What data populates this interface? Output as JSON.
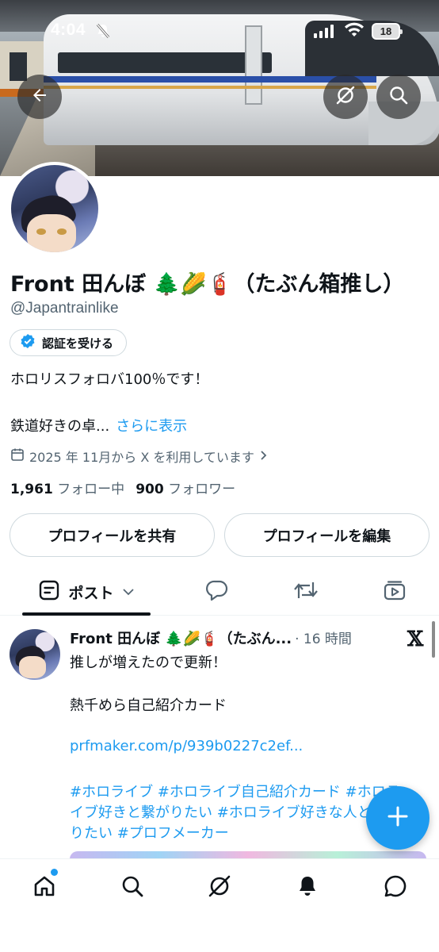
{
  "status_bar": {
    "time": "4:04",
    "battery": "18"
  },
  "profile": {
    "display_name": "Front 田んぼ 🌲🌽🧯（たぶん箱推し）",
    "handle": "@Japantrainlike",
    "verify_label": "認証を受ける",
    "bio_line1": "ホロリスフォロバ100％です！",
    "bio_line2": "鉄道好きの卓...",
    "show_more": "さらに表示",
    "joined": "2025 年 11月から X を利用しています",
    "following_count": "1,961",
    "following_label": "フォロー中",
    "followers_count": "900",
    "followers_label": "フォロワー",
    "share_button": "プロフィールを共有",
    "edit_button": "プロフィールを編集"
  },
  "tabs": {
    "posts_label": "ポスト"
  },
  "post": {
    "author": "Front 田んぼ 🌲🌽🧯（たぶん...",
    "time": "· 16 時間",
    "line1": "推しが増えたので更新！",
    "line2": "熱千めら自己紹介カード",
    "link": "prfmaker.com/p/939b0227c2ef...",
    "hashtags_line1": "#ホロライブ #ホロライブ自己紹介カード #ホロラ",
    "hashtags_line2": "イブ好きと繋がりたい #ホロライブ好きな人と繋が",
    "hashtags_line3": "りたい #プロフメーカー"
  },
  "colors": {
    "accent": "#1d9bf0",
    "text": "#0f1419",
    "secondary": "#536471",
    "border": "#cfd9de"
  },
  "icons": [
    "back-arrow-icon",
    "grok-icon",
    "search-icon",
    "verified-badge-icon",
    "calendar-icon",
    "chevron-right-icon",
    "posts-icon",
    "chevron-down-icon",
    "reply-icon",
    "repost-icon",
    "media-icon",
    "x-logo-icon",
    "plus-icon",
    "home-icon",
    "bell-icon",
    "messages-icon"
  ]
}
